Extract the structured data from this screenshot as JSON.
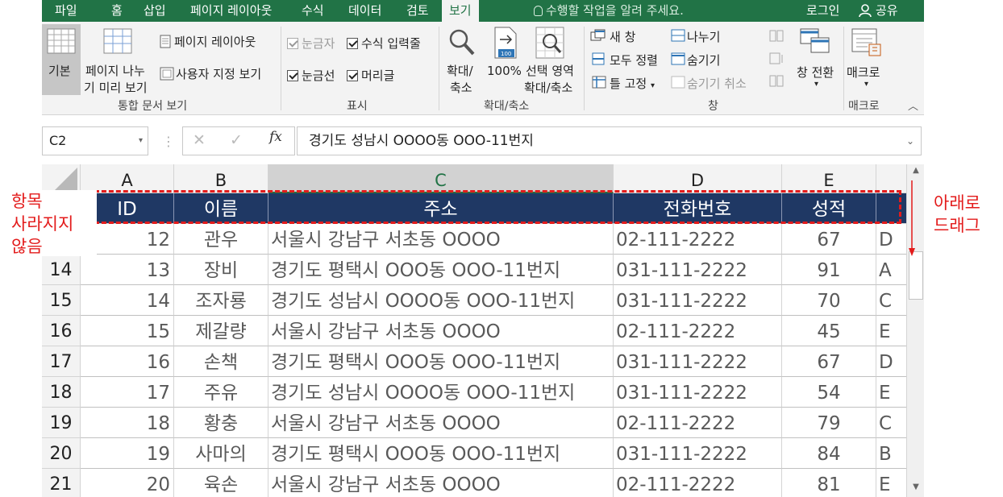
{
  "tabs": [
    {
      "label": "파일",
      "active": false
    },
    {
      "label": "홈",
      "active": false
    },
    {
      "label": "삽입",
      "active": false
    },
    {
      "label": "페이지 레이아웃",
      "active": false
    },
    {
      "label": "수식",
      "active": false
    },
    {
      "label": "데이터",
      "active": false
    },
    {
      "label": "검토",
      "active": false
    },
    {
      "label": "보기",
      "active": true
    }
  ],
  "tell_me": "수행할 작업을 알려 주세요.",
  "login": "로그인",
  "share": "공유",
  "ribbon": {
    "workbook_views": {
      "normal": "기본",
      "page_break_line1": "페이지 나누",
      "page_break_line2": "기 미리 보기",
      "page_layout": "페이지 레이아웃",
      "custom_views": "사용자 지정 보기",
      "group_label": "통합 문서 보기"
    },
    "show": {
      "ruler": "눈금자",
      "formula_bar": "수식 입력줄",
      "gridlines": "눈금선",
      "headings": "머리글",
      "group_label": "표시"
    },
    "zoom": {
      "zoom_line1": "확대/",
      "zoom_line2": "축소",
      "zoom_100": "100%",
      "zoom_sel_line1": "선택 영역",
      "zoom_sel_line2": "확대/축소",
      "badge": "100",
      "group_label": "확대/축소"
    },
    "window": {
      "new_window": "새 창",
      "arrange_all": "모두 정렬",
      "freeze_panes": "틀 고정",
      "split": "나누기",
      "hide": "숨기기",
      "unhide": "숨기기 취소",
      "switch_windows": "창 전환",
      "group_label": "창"
    },
    "macros": {
      "macros": "매크로",
      "group_label": "매크로"
    }
  },
  "formula_bar": {
    "name_box": "C2",
    "fx": "fx",
    "value": "경기도 성남시 OOOO동 OOO-11번지"
  },
  "columns": [
    "A",
    "B",
    "C",
    "D",
    "E"
  ],
  "header_row": {
    "row_label": "",
    "id": "ID",
    "name": "이름",
    "address": "주소",
    "phone": "전화번호",
    "score": "성적"
  },
  "rows": [
    {
      "row": "",
      "id": "12",
      "name": "관우",
      "address": "서울시 강남구 서초동 OOOO",
      "phone": "02-111-2222",
      "score": "67",
      "f": "D"
    },
    {
      "row": "14",
      "id": "13",
      "name": "장비",
      "address": "경기도 평택시 OOO동 OOO-11번지",
      "phone": "031-111-2222",
      "score": "91",
      "f": "A"
    },
    {
      "row": "15",
      "id": "14",
      "name": "조자룡",
      "address": "경기도 성남시 OOOO동 OOO-11번지",
      "phone": "031-111-2222",
      "score": "70",
      "f": "C"
    },
    {
      "row": "16",
      "id": "15",
      "name": "제갈량",
      "address": "서울시 강남구 서초동 OOOO",
      "phone": "02-111-2222",
      "score": "45",
      "f": "E"
    },
    {
      "row": "17",
      "id": "16",
      "name": "손책",
      "address": "경기도 평택시 OOO동 OOO-11번지",
      "phone": "031-111-2222",
      "score": "67",
      "f": "D"
    },
    {
      "row": "18",
      "id": "17",
      "name": "주유",
      "address": "경기도 성남시 OOOO동 OOO-11번지",
      "phone": "031-111-2222",
      "score": "54",
      "f": "E"
    },
    {
      "row": "19",
      "id": "18",
      "name": "황충",
      "address": "서울시 강남구 서초동 OOOO",
      "phone": "02-111-2222",
      "score": "79",
      "f": "C"
    },
    {
      "row": "20",
      "id": "19",
      "name": "사마의",
      "address": "경기도 평택시 OOO동 OOO-11번지",
      "phone": "031-111-2222",
      "score": "84",
      "f": "B"
    },
    {
      "row": "21",
      "id": "20",
      "name": "육손",
      "address": "서울시 강남구 서초동 OOOO",
      "phone": "02-111-2222",
      "score": "81",
      "f": "E"
    }
  ],
  "annotations": {
    "left": "항목\n사라지지\n않음",
    "right": "아래로\n드래그"
  },
  "colors": {
    "excel_green": "#217346",
    "header_fill": "#1f3864",
    "annotation_red": "#e31b1b"
  }
}
